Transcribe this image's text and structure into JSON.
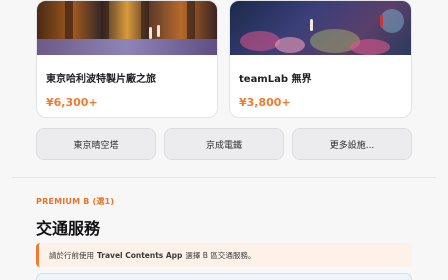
{
  "cards": [
    {
      "title": "東京哈利波特製片廠之旅",
      "price": "¥6,300+",
      "image_icon": "photo-studio-tour"
    },
    {
      "title": "teamLab 無界",
      "price": "¥3,800+",
      "image_icon": "photo-teamlab"
    }
  ],
  "buttons": [
    {
      "label": "東京晴空塔"
    },
    {
      "label": "京成電鐵"
    },
    {
      "label": "更多設施..."
    }
  ],
  "section": {
    "eyebrow": "PREMIUM B (選1)",
    "title": "交通服務",
    "notice_before": "請於行前使用",
    "notice_app": "Travel Contents App",
    "notice_after": "選擇 B 區交通服務。"
  },
  "colors": {
    "accent": "#f07b2f",
    "notice_bg": "#fdf1e8",
    "button_bg": "#ececee"
  }
}
